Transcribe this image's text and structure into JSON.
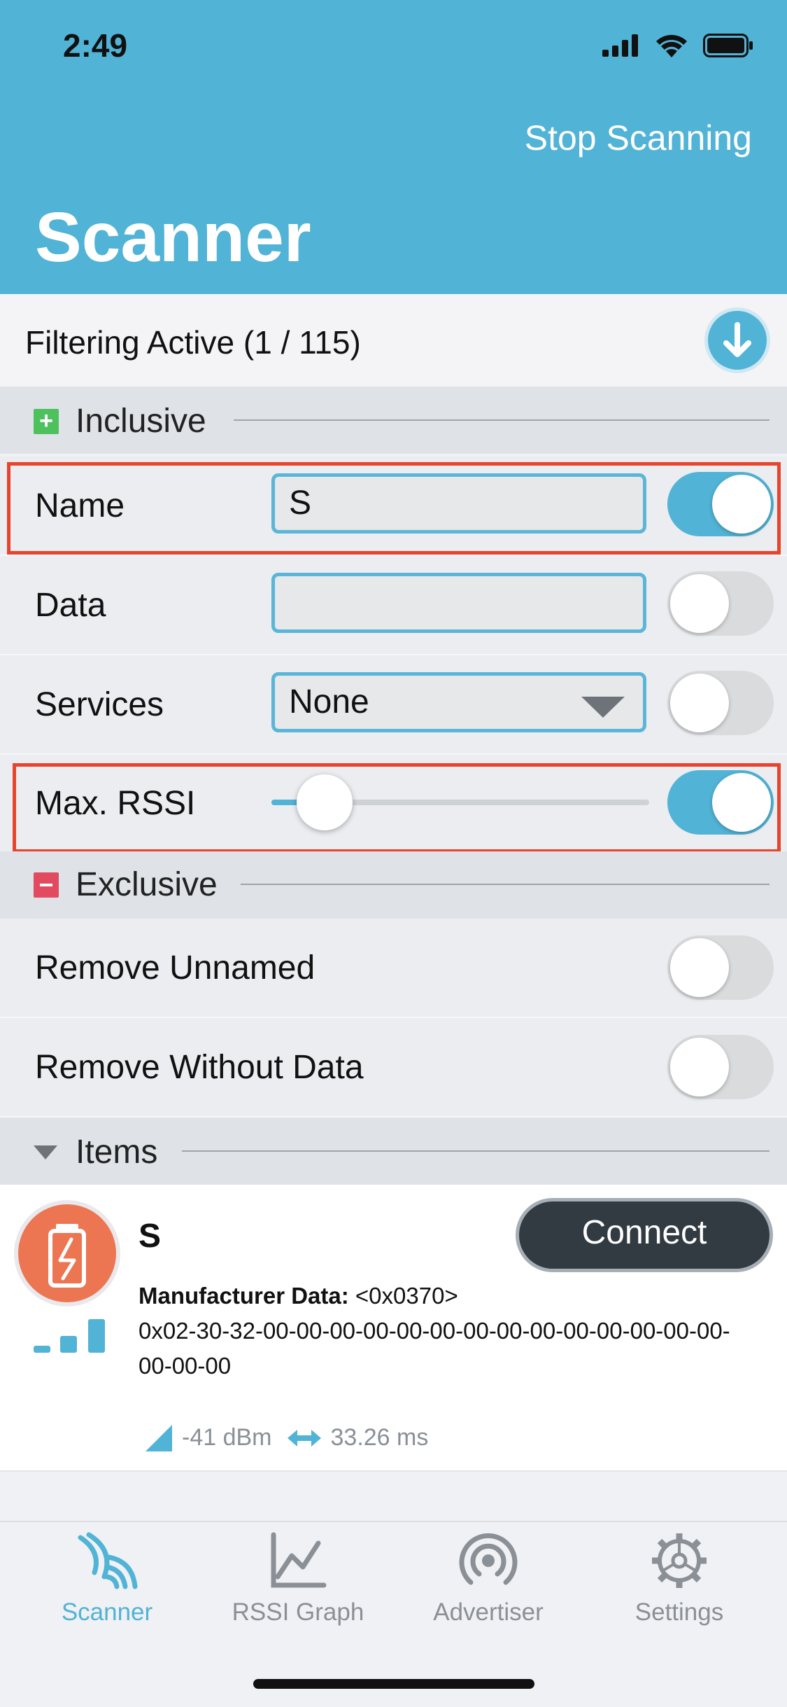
{
  "status_bar": {
    "time": "2:49"
  },
  "header": {
    "stop_label": "Stop Scanning",
    "title": "Scanner"
  },
  "filter": {
    "text": "Filtering Active (1 / 115)"
  },
  "inclusive": {
    "label": "Inclusive",
    "name": {
      "label": "Name",
      "value": "S",
      "enabled": true
    },
    "data": {
      "label": "Data",
      "value": "",
      "enabled": false
    },
    "services": {
      "label": "Services",
      "value": "None",
      "enabled": false
    },
    "rssi": {
      "label": "Max. RSSI",
      "slider_fraction": 0.1,
      "enabled": true
    }
  },
  "exclusive": {
    "label": "Exclusive",
    "remove_unnamed": {
      "label": "Remove Unnamed",
      "enabled": false
    },
    "remove_without_data": {
      "label": "Remove Without Data",
      "enabled": false
    }
  },
  "items": {
    "label": "Items",
    "list": [
      {
        "name": "S",
        "connect_label": "Connect",
        "mfr_label": "Manufacturer Data:",
        "mfr_id": " <0x0370>",
        "mfr_data": "0x02-30-32-00-00-00-00-00-00-00-00-00-00-00-00-00-00-00-00-00",
        "rssi": "-41 dBm",
        "interval": "33.26 ms"
      }
    ]
  },
  "tabs": [
    {
      "label": "Scanner",
      "icon": "scanner-icon",
      "active": true
    },
    {
      "label": "RSSI Graph",
      "icon": "graph-icon",
      "active": false
    },
    {
      "label": "Advertiser",
      "icon": "advertiser-icon",
      "active": false
    },
    {
      "label": "Settings",
      "icon": "gear-icon",
      "active": false
    }
  ],
  "colors": {
    "accent": "#51b3d6",
    "highlight": "#e8432d",
    "plus": "#4cc15c",
    "minus": "#e24a5f",
    "avatar": "#ec7552"
  }
}
